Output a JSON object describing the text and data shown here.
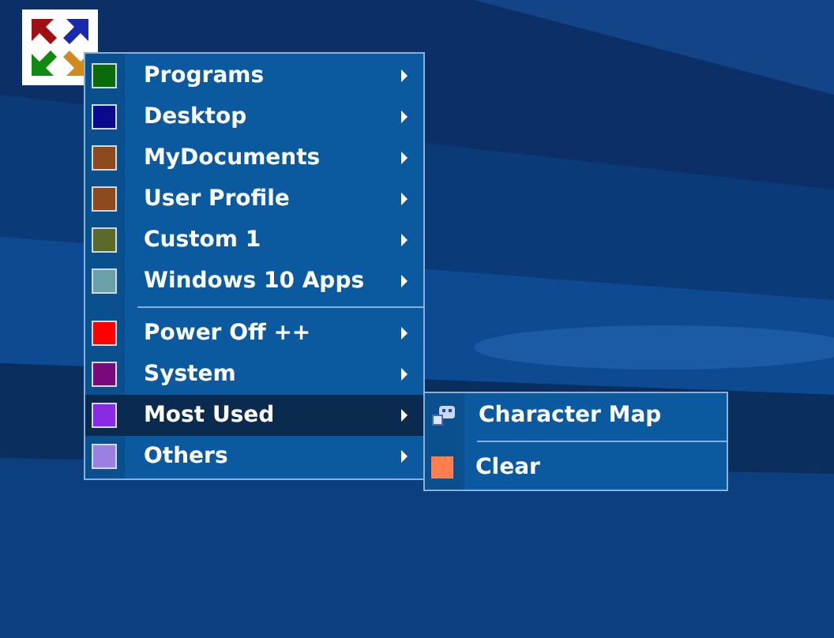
{
  "menu": {
    "items": [
      {
        "kind": "item",
        "label": "Programs",
        "color": "#0a6b0a",
        "selected": false
      },
      {
        "kind": "item",
        "label": "Desktop",
        "color": "#0a0a8c",
        "selected": false
      },
      {
        "kind": "item",
        "label": "MyDocuments",
        "color": "#8c4a1e",
        "selected": false
      },
      {
        "kind": "item",
        "label": "User Profile",
        "color": "#8c4a1e",
        "selected": false
      },
      {
        "kind": "item",
        "label": "Custom 1",
        "color": "#5a6a2a",
        "selected": false
      },
      {
        "kind": "item",
        "label": "Windows 10 Apps",
        "color": "#6aa0a8",
        "selected": false
      },
      {
        "kind": "separator"
      },
      {
        "kind": "item",
        "label": "Power Off ++",
        "color": "#ff0000",
        "selected": false
      },
      {
        "kind": "item",
        "label": "System",
        "color": "#7a0a7a",
        "selected": false
      },
      {
        "kind": "item",
        "label": "Most Used",
        "color": "#8a2be2",
        "selected": true
      },
      {
        "kind": "item",
        "label": "Others",
        "color": "#9a80e0",
        "selected": false
      }
    ]
  },
  "submenu": {
    "items": [
      {
        "kind": "app",
        "label": "Character Map"
      },
      {
        "kind": "separator"
      },
      {
        "kind": "swatch",
        "label": "Clear",
        "color": "#ff7f50"
      }
    ]
  }
}
